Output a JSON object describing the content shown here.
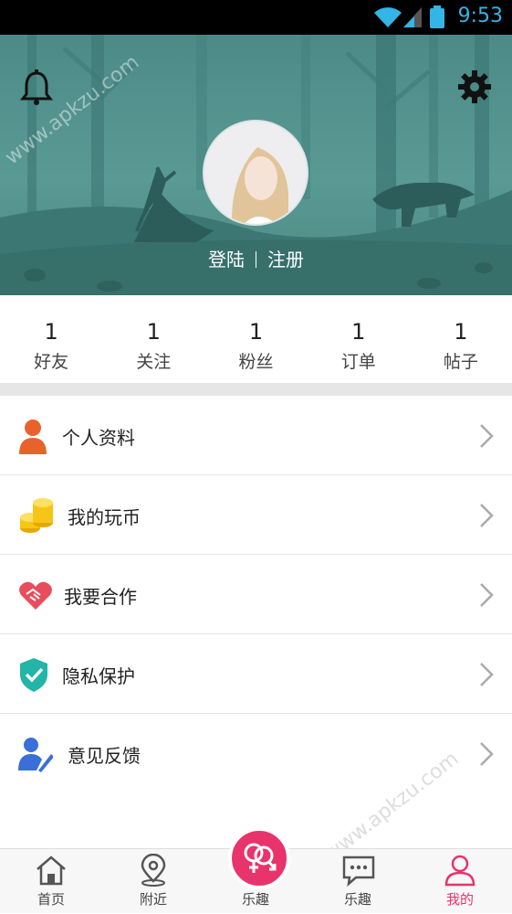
{
  "status_bar": {
    "time": "9:53"
  },
  "profile": {
    "login_label": "登陆",
    "register_label": "注册"
  },
  "stats": [
    {
      "count": "1",
      "label": "好友"
    },
    {
      "count": "1",
      "label": "关注"
    },
    {
      "count": "1",
      "label": "粉丝"
    },
    {
      "count": "1",
      "label": "订单"
    },
    {
      "count": "1",
      "label": "帖子"
    }
  ],
  "menu": [
    {
      "label": "个人资料",
      "icon": "person-icon",
      "color": "#e8632b"
    },
    {
      "label": "我的玩币",
      "icon": "coins-icon",
      "color": "#f5c518"
    },
    {
      "label": "我要合作",
      "icon": "handshake-heart-icon",
      "color": "#e84d5b"
    },
    {
      "label": "隐私保护",
      "icon": "shield-check-icon",
      "color": "#22b5a8"
    },
    {
      "label": "意见反馈",
      "icon": "feedback-user-icon",
      "color": "#3a6fd8"
    }
  ],
  "tabs": [
    {
      "label": "首页",
      "icon": "home-icon"
    },
    {
      "label": "附近",
      "icon": "location-pin-icon"
    },
    {
      "label": "乐趣",
      "icon": "gender-couple-icon"
    },
    {
      "label": "乐趣",
      "icon": "chat-bubble-icon"
    },
    {
      "label": "我的",
      "icon": "user-icon"
    }
  ],
  "watermark": "www.apkzu.com",
  "colors": {
    "accent": "#e8336d",
    "hero": "#4c8a87",
    "status_time": "#33b5e5"
  }
}
